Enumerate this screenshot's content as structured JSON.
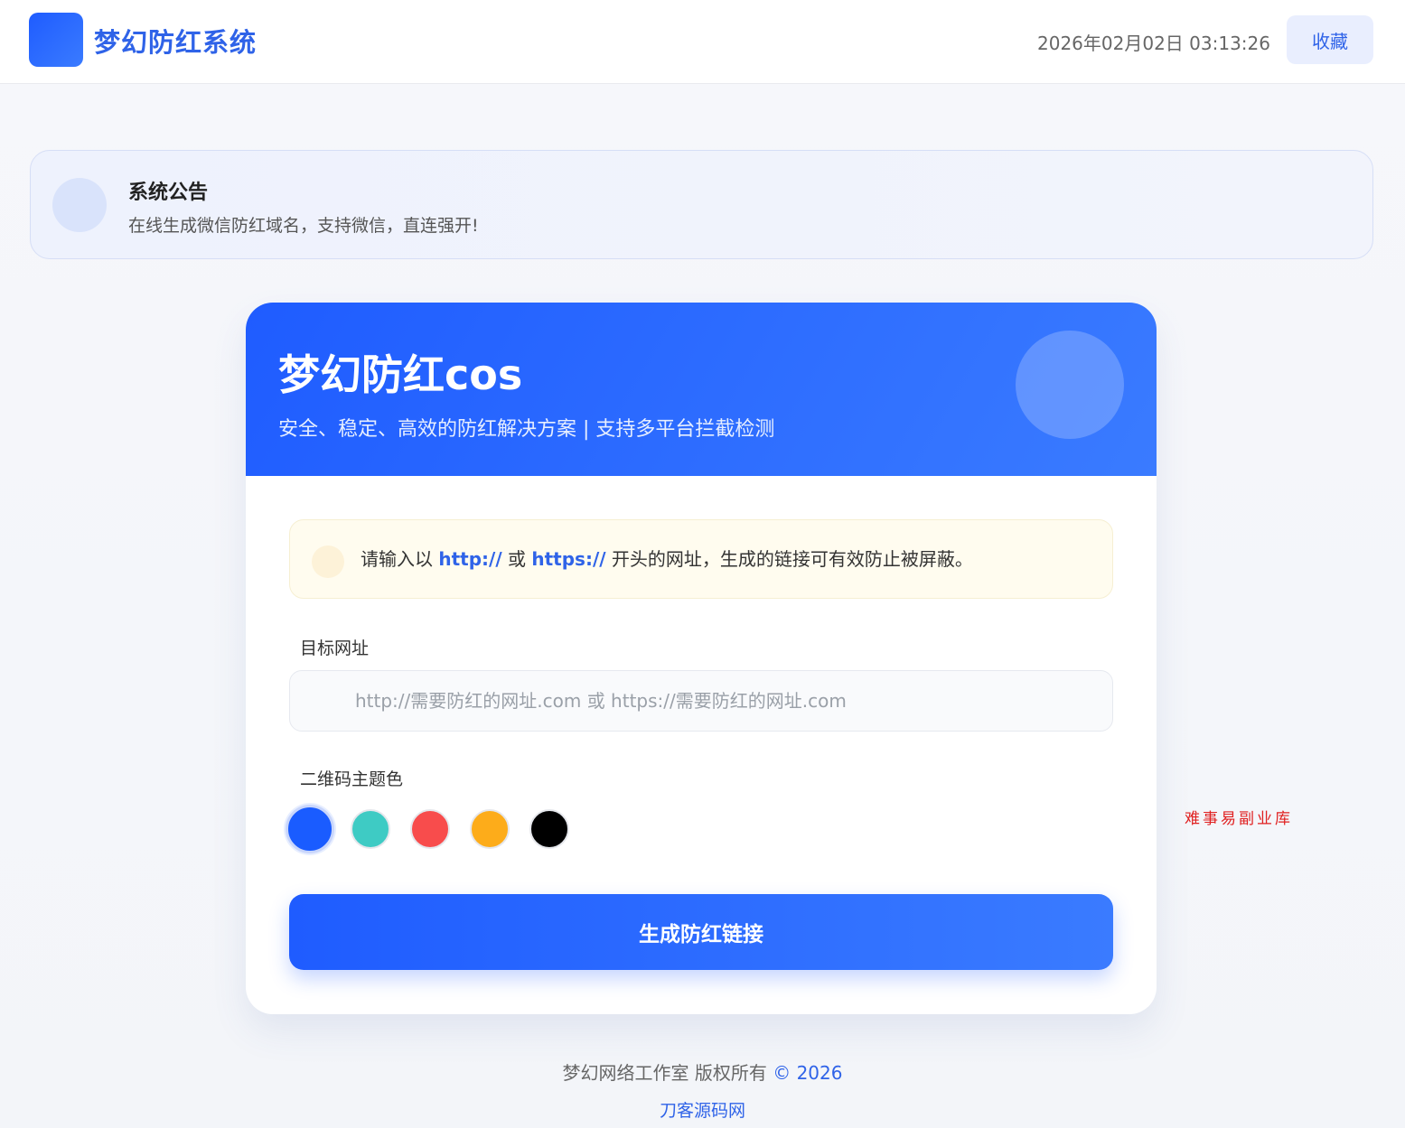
{
  "header": {
    "brand": "梦幻防红系统",
    "datetime": "2026年02月02日 03:13:26",
    "favorite_label": "收藏"
  },
  "notice": {
    "title": "系统公告",
    "text": "在线生成微信防红域名，支持微信，直连强开!"
  },
  "card": {
    "title": "梦幻防红cos",
    "subtitle": "安全、稳定、高效的防红解决方案 | 支持多平台拦截检测",
    "tip": {
      "prefix": "请输入以",
      "http": "http://",
      "or": "或",
      "https": "https://",
      "suffix": "开头的网址，生成的链接可有效防止被屏蔽。"
    },
    "url_label": "目标网址",
    "url_value": "",
    "url_placeholder": "http://需要防红的网址.com 或 https://需要防红的网址.com",
    "qr_label": "二维码主题色",
    "colors": [
      "#1a5cff",
      "#3ecbc4",
      "#f84c4c",
      "#fdac1a",
      "#000000"
    ],
    "selected_color": "#1a5cff",
    "generate_label": "生成防红链接"
  },
  "watermark": "难事易副业库",
  "footer": {
    "copyright": "梦幻网络工作室 版权所有",
    "copy_symbol_year": "© 2026",
    "link": "刀客源码网"
  }
}
